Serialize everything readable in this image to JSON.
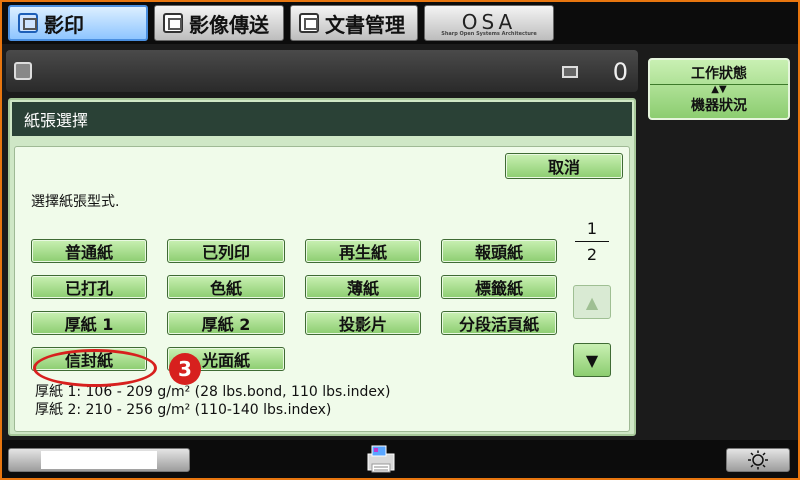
{
  "tabs": [
    {
      "label": "影印",
      "active": true
    },
    {
      "label": "影像傳送",
      "active": false
    },
    {
      "label": "文書管理",
      "active": false
    }
  ],
  "osa_logo": {
    "text": "OSA",
    "tagline": "Sharp Open Systems Architecture"
  },
  "status": {
    "copy_count": "0"
  },
  "side_panel": {
    "job_status": "工作狀態",
    "machine_status": "機器狀況",
    "toggle_glyph": "▲▼"
  },
  "panel": {
    "title": "紙張選擇",
    "cancel_label": "取消",
    "instruction": "選擇紙張型式.",
    "paper_types": [
      "普通紙",
      "已列印",
      "再生紙",
      "報頭紙",
      "已打孔",
      "色紙",
      "薄紙",
      "標籤紙",
      "厚紙 1",
      "厚紙 2",
      "投影片",
      "分段活頁紙",
      "信封紙",
      "光面紙"
    ],
    "page_current": "1",
    "page_total": "2",
    "scroll_up_glyph": "▲",
    "scroll_down_glyph": "▼",
    "notes": [
      "厚紙 1: 106 - 209 g/m² (28 lbs.bond, 110 lbs.index)",
      "厚紙 2: 210 - 256 g/m² (110-140 lbs.index)"
    ]
  },
  "annotation": {
    "step_number": "3"
  },
  "colors": {
    "frame": "#e8760f",
    "button_green": "#8ccd70",
    "header": "#2a4136",
    "highlight": "#d7201e"
  }
}
